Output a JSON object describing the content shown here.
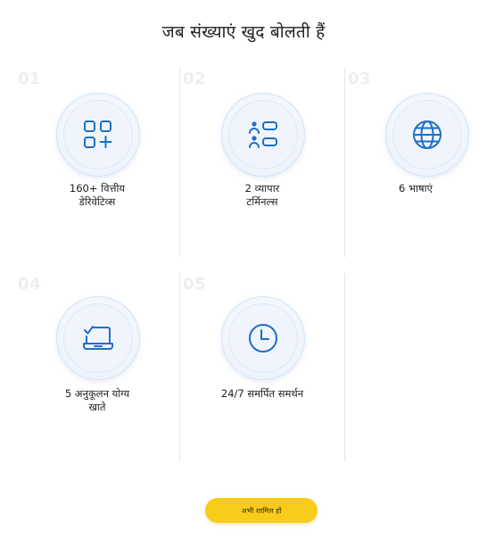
{
  "header": {
    "title": "जब संख्याएं खुद बोलती हैं"
  },
  "features": [
    {
      "number": "01",
      "icon": "apps-grid-icon",
      "line1": "160+ वित्तीय",
      "line2": "डेरिवेटिव्स"
    },
    {
      "number": "02",
      "icon": "users-list-icon",
      "line1": "2 व्यापार",
      "line2": "टर्मिनल्स"
    },
    {
      "number": "03",
      "icon": "globe-icon",
      "line1": "6 भाषाएं",
      "line2": ""
    },
    {
      "number": "04",
      "icon": "laptop-check-icon",
      "line1": "5 अनुकूलन योग्य",
      "line2": "खाते"
    },
    {
      "number": "05",
      "icon": "clock-icon",
      "line1": "24/7 समर्पित समर्थन",
      "line2": ""
    }
  ],
  "cta": {
    "label": "अभी शामिल हों"
  },
  "colors": {
    "icon_stroke": "#1f6fc4",
    "cta_background": "#f9cc1c",
    "number_color": "#eceef1",
    "divider": "#e4e6ea"
  }
}
